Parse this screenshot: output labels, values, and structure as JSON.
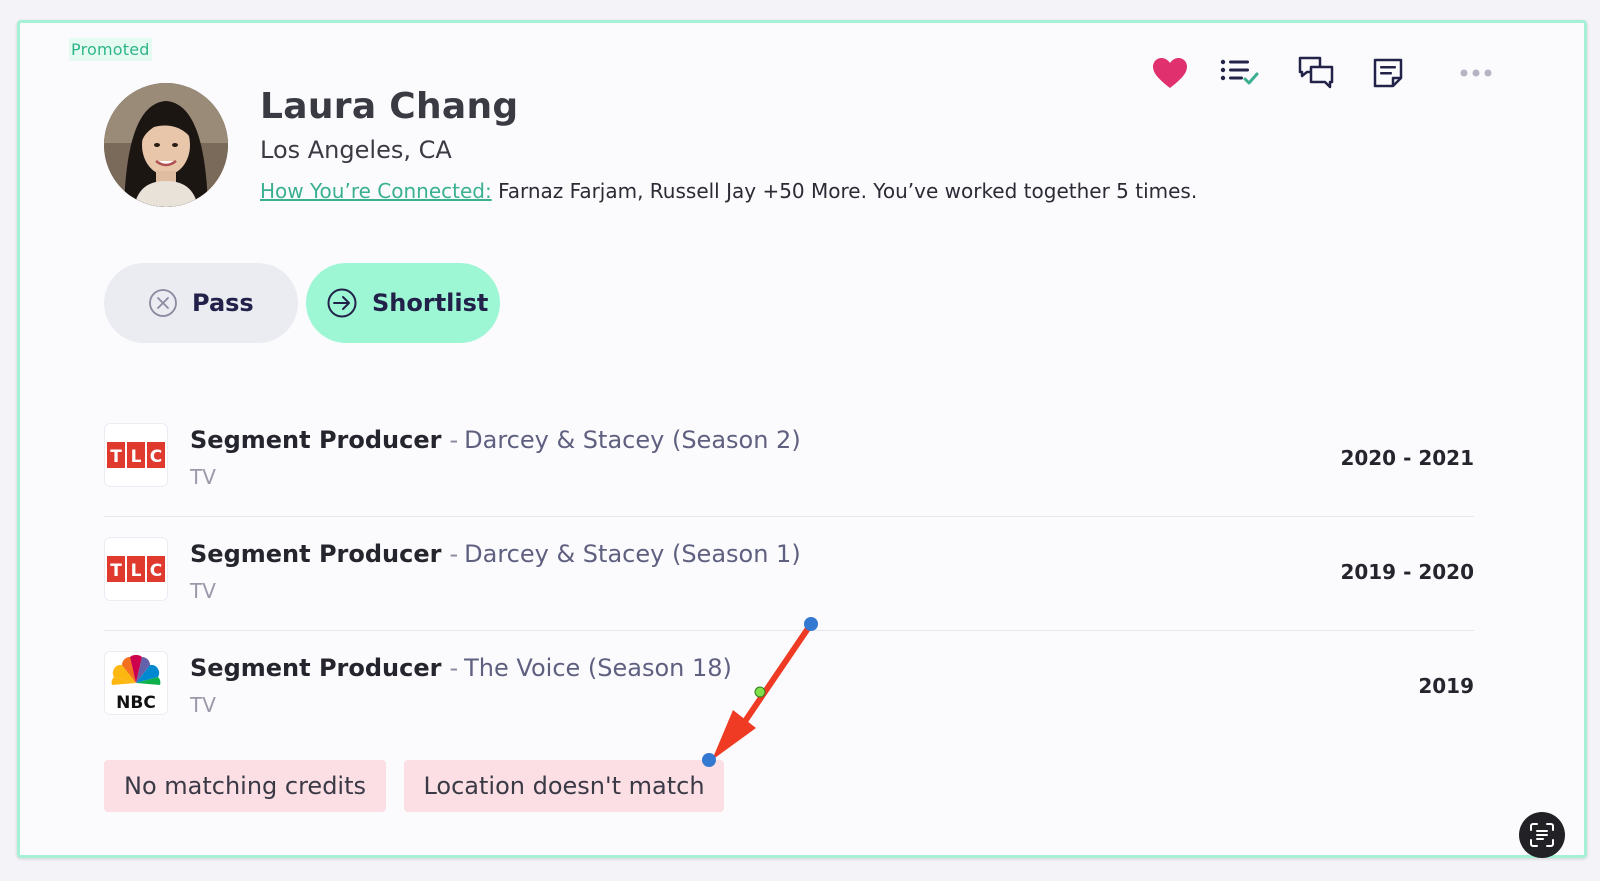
{
  "badge": {
    "promoted": "Promoted"
  },
  "profile": {
    "name": "Laura Chang",
    "location": "Los Angeles, CA",
    "connection_link": "How You’re Connected:",
    "connection_text": "Farnaz Farjam, Russell Jay +50 More. You’ve worked together 5 times."
  },
  "toolbar": {
    "icons": [
      "heart-icon",
      "checklist-icon",
      "chat-icon",
      "note-icon",
      "more-icon"
    ],
    "heart_color": "#e0306d"
  },
  "actions": {
    "pass_label": "Pass",
    "shortlist_label": "Shortlist"
  },
  "credits": [
    {
      "logo": "TLC",
      "role": "Segment Producer",
      "separator": "-",
      "show": "Darcey & Stacey (Season 2)",
      "type": "TV",
      "years": "2020 - 2021"
    },
    {
      "logo": "TLC",
      "role": "Segment Producer",
      "separator": "-",
      "show": "Darcey & Stacey (Season 1)",
      "type": "TV",
      "years": "2019 - 2020"
    },
    {
      "logo": "NBC",
      "role": "Segment Producer",
      "separator": "-",
      "show": "The Voice (Season 18)",
      "type": "TV",
      "years": "2019"
    }
  ],
  "tags": [
    "No matching credits",
    "Location doesn't match"
  ],
  "colors": {
    "accent": "#9ef7d4",
    "tag_bg": "#fbdfe4",
    "annotation_arrow": "#ef3b24"
  }
}
